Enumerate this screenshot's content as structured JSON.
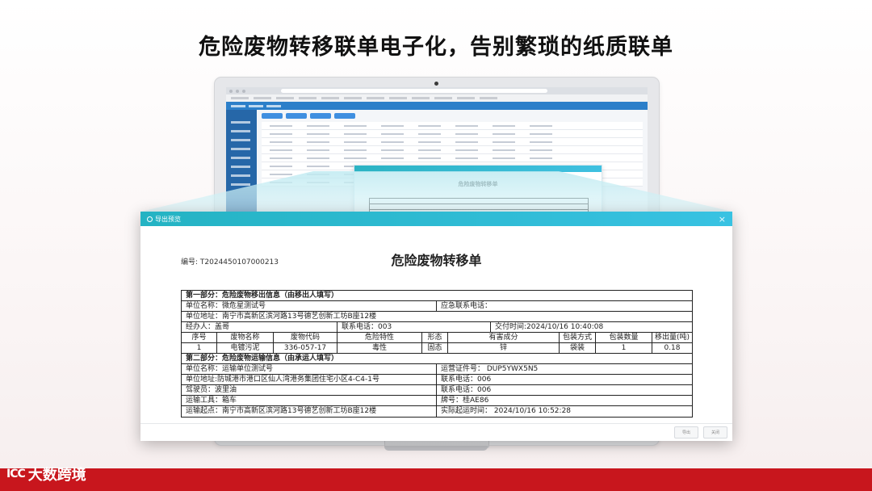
{
  "headline": "危险废物转移联单电子化，告别繁琐的纸质联单",
  "brand": {
    "mark": "ICC",
    "name": "大数跨境"
  },
  "inner_dialog": {
    "title": "危险废物转移单"
  },
  "dialog": {
    "title": "导出预览",
    "close": "×",
    "doc_no": "编号: T2024450107000213",
    "doc_title": "危险废物转移单",
    "section1": "第一部分：危险废物移出信息（由移出人填写）",
    "unit_name": "单位名称：微危星测试号",
    "emergency_phone": "应急联系电话：",
    "unit_address": "单位地址：南宁市高新区滨河路13号德艺创新工坊B座12楼",
    "handler": "经办人：盖哥",
    "contact_phone": "联系电话：003",
    "handover_time": "交付时间:2024/10/16 10:40:08",
    "waste_headers": [
      "序号",
      "废物名称",
      "废物代码",
      "危险特性",
      "形态",
      "有害成分",
      "包装方式",
      "包装数量",
      "移出量(吨)"
    ],
    "waste_row": [
      "1",
      "电镀污泥",
      "336-057-17",
      "毒性",
      "固态",
      "锌",
      "袋装",
      "1",
      "0.18"
    ],
    "section2": "第二部分：危险废物运输信息（由承运人填写）",
    "transport_unit": "单位名称：运输单位测试号",
    "permit_no": "运营证件号：  DUP5YWX5N5",
    "transport_address": "单位地址:防城港市港口区仙人湾港务集团住宅小区4-C4-1号",
    "transport_phone": "联系电话：006",
    "driver": "驾驶员：波里油",
    "driver_phone": "联系电话：006",
    "vehicle": "运输工具：箱车",
    "plate": "牌号：桂AE86",
    "origin": "运输起点：南宁市高新区滨河路13号德艺创新工坊B座12楼",
    "actual_start": "实际起运时间：  2024/10/16 10:52:28",
    "buttons": {
      "export": "导出",
      "close": "关闭"
    }
  }
}
